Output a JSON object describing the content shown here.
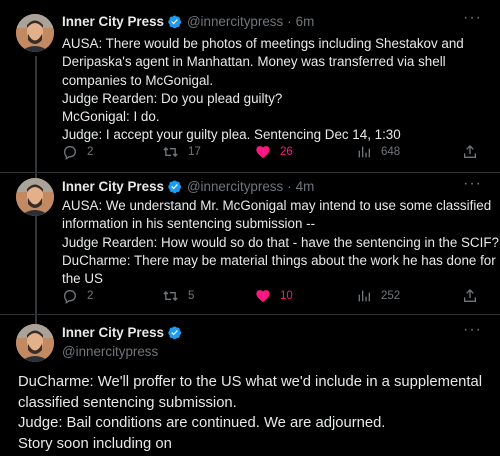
{
  "colors": {
    "background": "#000000",
    "text": "#e7e9ea",
    "muted": "#71767b",
    "verified_blue": "#1d9bf0",
    "like_pink": "#f91880",
    "divider": "#2f3336"
  },
  "tweets": [
    {
      "author_name": "Inner City Press",
      "handle": "@innercitypress",
      "separator": "·",
      "time": "6m",
      "more": "···",
      "lines": [
        "AUSA: There would be photos of meetings including Shestakov and",
        "Deripaska's agent in Manhattan. Money was transferred via shell",
        "companies to McGonigal.",
        "Judge Rearden: Do you plead guilty?",
        "McGonigal: I do.",
        "Judge: I accept your guilty plea. Sentencing Dec 14, 1:30"
      ],
      "replies": "2",
      "reposts": "17",
      "likes": "26",
      "views": "648",
      "liked": true
    },
    {
      "author_name": "Inner City Press",
      "handle": "@innercitypress",
      "separator": "·",
      "time": "4m",
      "more": "···",
      "lines": [
        "AUSA: We understand Mr. McGonigal may intend to use some classified",
        "information in his sentencing submission --",
        "Judge Rearden: How would so do that - have the sentencing in the SCIF?",
        "DuCharme: There may be material things about the work he has done for",
        "the US"
      ],
      "replies": "2",
      "reposts": "5",
      "likes": "10",
      "views": "252",
      "liked": true
    },
    {
      "author_name": "Inner City Press",
      "handle": "@innercitypress",
      "more": "···",
      "lines": [
        "DuCharme: We'll proffer to the US what we'd include in a supplemental",
        "classified sentencing submission.",
        "Judge: Bail conditions are continued. We are adjourned.",
        "Story soon including on"
      ]
    }
  ]
}
